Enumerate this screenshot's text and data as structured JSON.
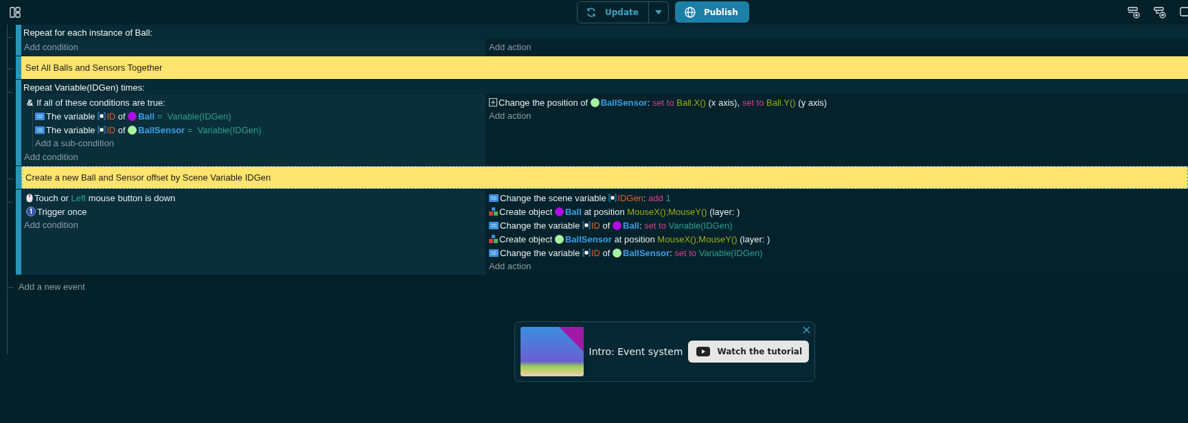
{
  "toolbar": {
    "update_label": "Update",
    "publish_label": "Publish"
  },
  "events": [
    {
      "kind": "standard",
      "header": "Repeat for each instance of Ball:",
      "add_condition": "Add condition",
      "add_action": "Add action"
    },
    {
      "kind": "comment",
      "text": "Set All Balls and Sensors Together",
      "selected": false
    },
    {
      "kind": "standard",
      "header": "Repeat Variable(IDGen) times:",
      "conditions": [
        {
          "kind": "group",
          "symbol": "&",
          "segments": [
            {
              "kind": "text",
              "text": "If all of these conditions are true:"
            }
          ],
          "add_sub": "Add a sub-condition",
          "children": [
            {
              "kind": "variable",
              "segments": [
                {
                  "kind": "text",
                  "text": "The variable "
                },
                {
                  "kind": "var",
                  "text": "ID"
                },
                {
                  "kind": "text",
                  "text": " of "
                },
                {
                  "kind": "object",
                  "text": "Ball",
                  "color": "#b10ae6"
                },
                {
                  "kind": "value",
                  "text": " =  Variable(IDGen)"
                }
              ]
            },
            {
              "kind": "variable",
              "segments": [
                {
                  "kind": "text",
                  "text": "The variable "
                },
                {
                  "kind": "var",
                  "text": "ID"
                },
                {
                  "kind": "text",
                  "text": " of "
                },
                {
                  "kind": "object",
                  "text": "BallSensor",
                  "color": "#a6f2a2"
                },
                {
                  "kind": "value",
                  "text": " =  Variable(IDGen)"
                }
              ]
            }
          ]
        }
      ],
      "actions": [
        {
          "kind": "position",
          "segments": [
            {
              "kind": "text",
              "text": "Change the position of "
            },
            {
              "kind": "object",
              "text": "BallSensor",
              "color": "#a6f2a2"
            },
            {
              "kind": "text",
              "text": ": "
            },
            {
              "kind": "op",
              "text": "set to "
            },
            {
              "kind": "expr",
              "text": "Ball.X()"
            },
            {
              "kind": "text",
              "text": " (x axis), "
            },
            {
              "kind": "op",
              "text": "set to "
            },
            {
              "kind": "expr",
              "text": "Ball.Y()"
            },
            {
              "kind": "text",
              "text": " (y axis)"
            }
          ]
        }
      ],
      "add_condition": "Add condition",
      "add_action": "Add action"
    },
    {
      "kind": "comment",
      "text": "Create a new Ball and Sensor offset by Scene Variable IDGen",
      "selected": true
    },
    {
      "kind": "standard",
      "conditions": [
        {
          "kind": "mouse",
          "segments": [
            {
              "kind": "text",
              "text": "Touch or "
            },
            {
              "kind": "value",
              "text": "Left"
            },
            {
              "kind": "text",
              "text": " mouse button is down"
            }
          ]
        },
        {
          "kind": "once",
          "segments": [
            {
              "kind": "text",
              "text": "Trigger once"
            }
          ]
        }
      ],
      "actions": [
        {
          "kind": "variable",
          "segments": [
            {
              "kind": "text",
              "text": "Change the scene variable "
            },
            {
              "kind": "scenevar",
              "text": "IDGen"
            },
            {
              "kind": "text",
              "text": ": "
            },
            {
              "kind": "op",
              "text": "add "
            },
            {
              "kind": "value",
              "text": "1"
            }
          ]
        },
        {
          "kind": "create",
          "segments": [
            {
              "kind": "text",
              "text": "Create object "
            },
            {
              "kind": "object",
              "text": "Ball",
              "color": "#b10ae6"
            },
            {
              "kind": "text",
              "text": " at position "
            },
            {
              "kind": "expr",
              "text": "MouseX();MouseY()"
            },
            {
              "kind": "text",
              "text": " (layer: )"
            }
          ]
        },
        {
          "kind": "variable",
          "segments": [
            {
              "kind": "text",
              "text": "Change the variable "
            },
            {
              "kind": "var",
              "text": "ID"
            },
            {
              "kind": "text",
              "text": " of "
            },
            {
              "kind": "object",
              "text": "Ball",
              "color": "#b10ae6"
            },
            {
              "kind": "text",
              "text": ": "
            },
            {
              "kind": "op",
              "text": "set to "
            },
            {
              "kind": "value",
              "text": "Variable(IDGen)"
            }
          ]
        },
        {
          "kind": "create",
          "segments": [
            {
              "kind": "text",
              "text": "Create object "
            },
            {
              "kind": "object",
              "text": "BallSensor",
              "color": "#a6f2a2"
            },
            {
              "kind": "text",
              "text": " at position "
            },
            {
              "kind": "expr",
              "text": "MouseX();MouseY()"
            },
            {
              "kind": "text",
              "text": " (layer: )"
            }
          ]
        },
        {
          "kind": "variable",
          "segments": [
            {
              "kind": "text",
              "text": "Change the variable "
            },
            {
              "kind": "var",
              "text": "ID"
            },
            {
              "kind": "text",
              "text": " of "
            },
            {
              "kind": "object",
              "text": "BallSensor",
              "color": "#a6f2a2"
            },
            {
              "kind": "text",
              "text": ": "
            },
            {
              "kind": "op",
              "text": "set to "
            },
            {
              "kind": "value",
              "text": "Variable(IDGen)"
            }
          ]
        }
      ],
      "add_condition": "Add condition",
      "add_action": "Add action"
    }
  ],
  "add_event": "Add a new event",
  "tutorial": {
    "title": "Intro: Event system",
    "button": "Watch the tutorial"
  }
}
